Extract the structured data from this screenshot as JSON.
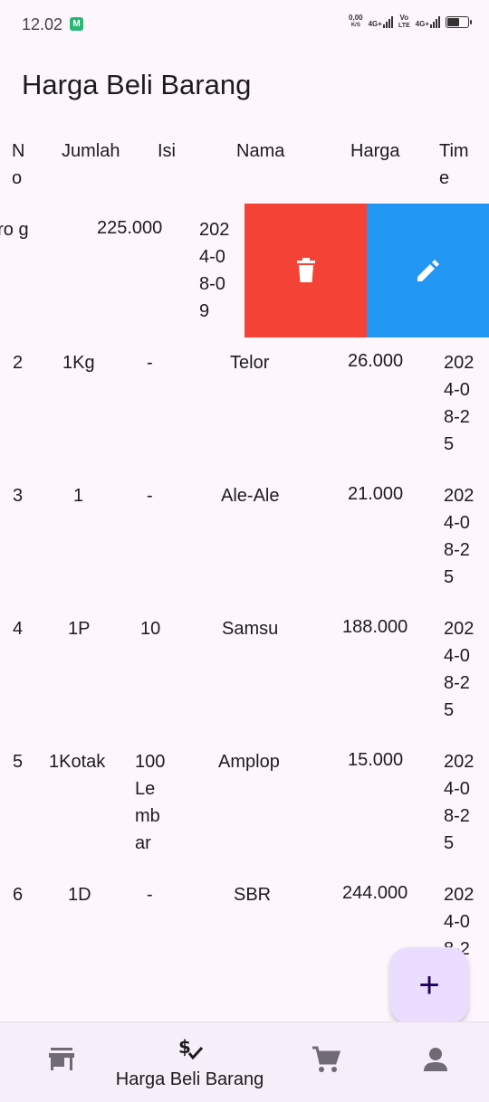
{
  "status_bar": {
    "time": "12.02",
    "net_speed_value": "0,00",
    "net_speed_unit": "K/S",
    "sig1_label": "4G+",
    "sig2_label_top": "Vo",
    "sig2_label_bottom": "LTE",
    "sig3_label": "4G+"
  },
  "app_bar": {
    "title": "Harga Beli Barang"
  },
  "table": {
    "headers": {
      "no": "No",
      "jumlah": "Jumlah",
      "isi": "Isi",
      "nama": "Nama",
      "harga": "Harga",
      "time": "Time"
    },
    "swiped_row": {
      "nama_fragment": "oro g",
      "harga": "225.000",
      "time": "2024-08-09"
    },
    "rows": [
      {
        "no": "2",
        "jumlah": "1Kg",
        "isi": "-",
        "nama": "Telor",
        "harga": "26.000",
        "time": "2024-08-25"
      },
      {
        "no": "3",
        "jumlah": "1",
        "isi": "-",
        "nama": "Ale-Ale",
        "harga": "21.000",
        "time": "2024-08-25"
      },
      {
        "no": "4",
        "jumlah": "1P",
        "isi": "10",
        "nama": "Samsu",
        "harga": "188.000",
        "time": "2024-08-25"
      },
      {
        "no": "5",
        "jumlah": "1Kotak",
        "isi": "100 Lembar",
        "nama": "Amplop",
        "harga": "15.000",
        "time": "2024-08-25"
      },
      {
        "no": "6",
        "jumlah": "1D",
        "isi": "-",
        "nama": "SBR",
        "harga": "244.000",
        "time": "2024-08-2"
      }
    ],
    "actions": {
      "delete_icon": "trash-icon",
      "edit_icon": "pencil-icon",
      "delete_color": "#f44336",
      "edit_color": "#2196f3"
    }
  },
  "fab": {
    "symbol": "+"
  },
  "bottom_nav": {
    "items": [
      {
        "icon": "store-icon",
        "label": ""
      },
      {
        "icon": "price-check-icon",
        "label": "Harga Beli Barang"
      },
      {
        "icon": "cart-icon",
        "label": ""
      },
      {
        "icon": "person-icon",
        "label": ""
      }
    ]
  },
  "colors": {
    "background": "#fdf7fd",
    "fab": "#eaddff",
    "nav_bg": "#f6eef8"
  }
}
